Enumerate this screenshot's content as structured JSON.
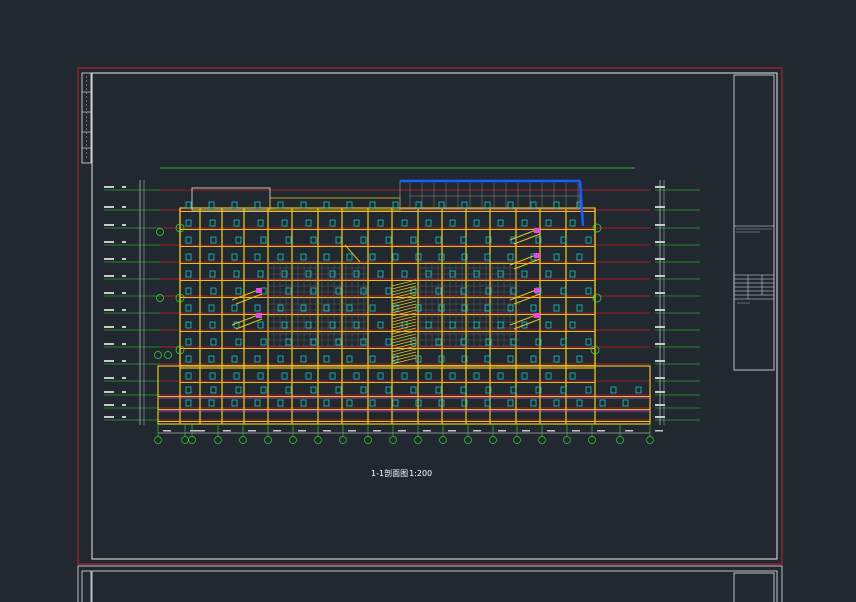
{
  "drawing": {
    "section_caption": "1-1剖面图",
    "scale_text": "1:200"
  },
  "colors": {
    "background": "#212830",
    "sheet_border": "#c0242a",
    "frame": "#ffffff",
    "structure": "#e8c21c",
    "floor_line": "#d21e1e",
    "grid_marker": "#33d633",
    "window": "#19c8c8",
    "stair": "#e14be1",
    "roof_frame": "#1a5cff"
  }
}
